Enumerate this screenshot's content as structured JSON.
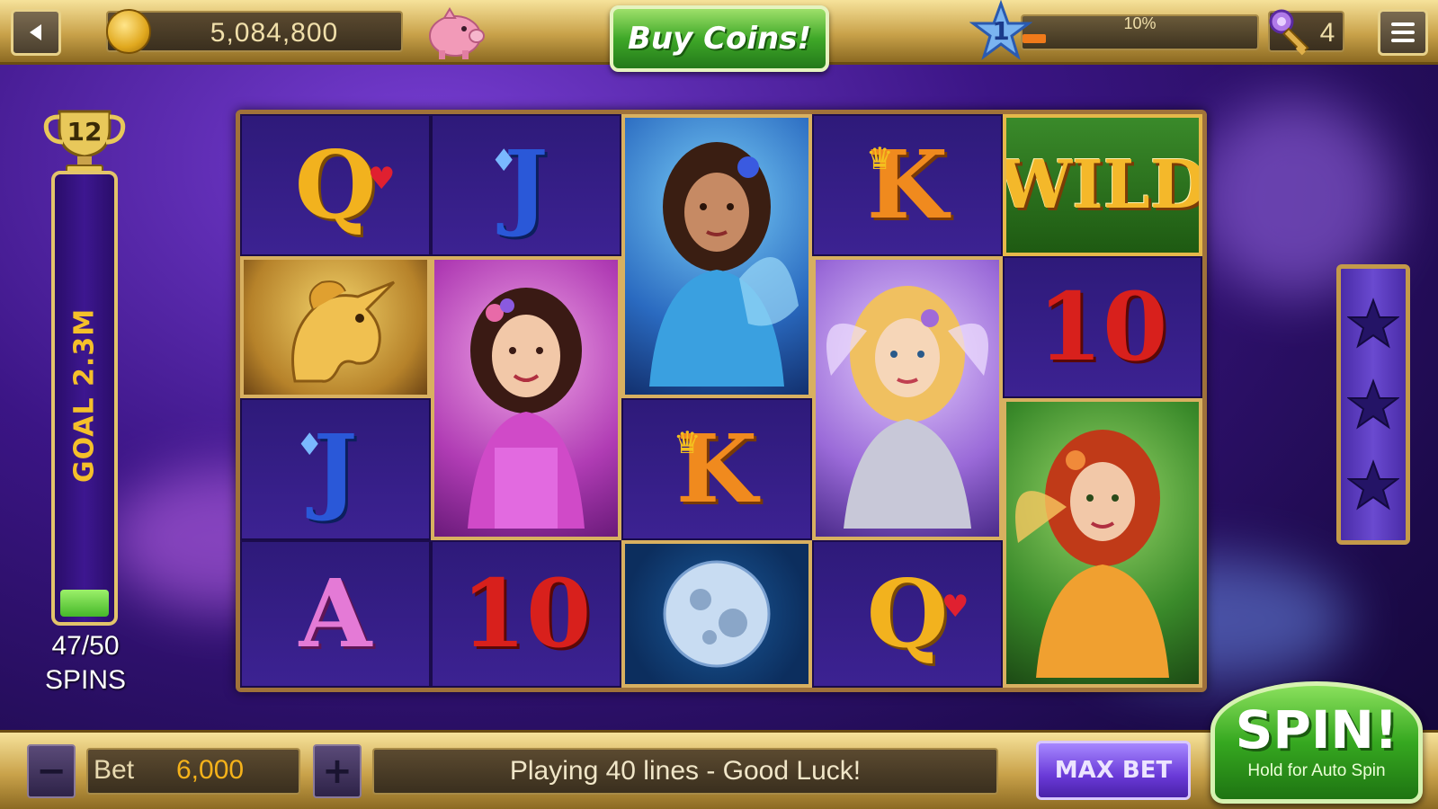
{
  "header": {
    "coin_balance": "5,084,800",
    "buy_coins_label": "Buy Coins!",
    "level": "1",
    "xp_percent_label": "10%",
    "xp_progress": 0.1,
    "keys_count": "4"
  },
  "goal_meter": {
    "trophy_level": "12",
    "goal_label": "GOAL 2.3M",
    "spins_count": "47/50",
    "spins_label": "SPINS",
    "progress": 0.06
  },
  "reels": {
    "columns": [
      [
        "Q",
        "unicorn",
        "J",
        "A"
      ],
      [
        "J",
        "fairy-pink",
        "fairy-pink",
        "10"
      ],
      [
        "fairy-blue",
        "fairy-blue",
        "K",
        "moon"
      ],
      [
        "K",
        "fairy-blonde",
        "fairy-blonde",
        "Q"
      ],
      [
        "WILD",
        "10",
        "fairy-red",
        "fairy-red"
      ]
    ]
  },
  "star_meter": {
    "stars_total": 3,
    "stars_filled": 0
  },
  "footer": {
    "bet_label": "Bet",
    "bet_value": "6,000",
    "status_message": "Playing 40 lines - Good Luck!",
    "max_bet_label": "MAX BET",
    "spin_label": "SPIN!",
    "spin_sublabel": "Hold for Auto Spin"
  },
  "colors": {
    "gold_frame": "#c9a24a",
    "background_purple": "#3b1585",
    "spin_green": "#36a820",
    "max_bet_purple": "#6a3ad8"
  },
  "icons": {
    "back": "back-arrow-icon",
    "coin": "coin-icon",
    "piggy": "piggy-bank-icon",
    "level": "star-level-icon",
    "key": "key-icon",
    "menu": "hamburger-menu-icon",
    "trophy": "trophy-icon"
  }
}
